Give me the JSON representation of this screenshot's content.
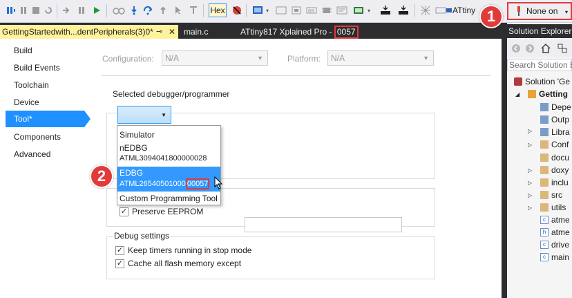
{
  "toolbar": {
    "hex_label": "Hex",
    "device_label": "ATtiny",
    "tool_selector_label": "None on"
  },
  "tabs": {
    "active_label": "GettingStartedwith...dentPeripherals(3)0*",
    "pin_glyph": "⊸",
    "close_glyph": "✕",
    "second_label": "main.c",
    "device_tab_prefix": "ATtiny817 Xplained Pro - ",
    "device_tab_serial": "0057"
  },
  "nav": {
    "items": [
      "Build",
      "Build Events",
      "Toolchain",
      "Device",
      "Tool*",
      "Components",
      "Advanced"
    ],
    "selected_index": 4
  },
  "config": {
    "configuration_label": "Configuration:",
    "configuration_value": "N/A",
    "platform_label": "Platform:",
    "platform_value": "N/A"
  },
  "debugger": {
    "group_title": "Selected debugger/programmer",
    "options": [
      {
        "name": "Simulator",
        "serial": ""
      },
      {
        "name": "nEDBG",
        "serial": "ATML3094041800000028"
      },
      {
        "name": "EDBG",
        "serial_prefix": "ATML26540501000",
        "serial_highlight": "00057"
      },
      {
        "name": "Custom Programming Tool",
        "serial": ""
      }
    ],
    "selected_option": "EDBG"
  },
  "programming": {
    "preserve_eeprom_label": "Preserve EEPROM",
    "preserve_eeprom_checked": true
  },
  "debug_settings": {
    "group_title": "Debug settings",
    "keep_timers_label": "Keep timers running in stop mode",
    "keep_timers_checked": true,
    "cache_flash_label": "Cache all flash memory except",
    "cache_flash_checked": true,
    "cache_flash_value": ""
  },
  "callouts": [
    "1",
    "2"
  ],
  "solution_explorer": {
    "title": "Solution Explorer",
    "search_placeholder": "Search Solution E",
    "tree": [
      {
        "label": "Solution 'Ge",
        "type": "solution",
        "level": 0
      },
      {
        "label": "Getting",
        "type": "project",
        "level": 1,
        "bold": true
      },
      {
        "label": "Depe",
        "type": "ref",
        "level": 2
      },
      {
        "label": "Outp",
        "type": "ref",
        "level": 2
      },
      {
        "label": "Libra",
        "type": "folder",
        "level": 2
      },
      {
        "label": "Conf",
        "type": "folder",
        "level": 2
      },
      {
        "label": "docu",
        "type": "folder",
        "level": 2
      },
      {
        "label": "doxy",
        "type": "folder",
        "level": 2
      },
      {
        "label": "inclu",
        "type": "folder",
        "level": 2
      },
      {
        "label": "src",
        "type": "folder",
        "level": 2
      },
      {
        "label": "utils",
        "type": "folder",
        "level": 2
      },
      {
        "label": "atme",
        "type": "c",
        "level": 2
      },
      {
        "label": "atme",
        "type": "h",
        "level": 2
      },
      {
        "label": "drive",
        "type": "c",
        "level": 2
      },
      {
        "label": "main",
        "type": "c",
        "level": 2
      }
    ]
  }
}
